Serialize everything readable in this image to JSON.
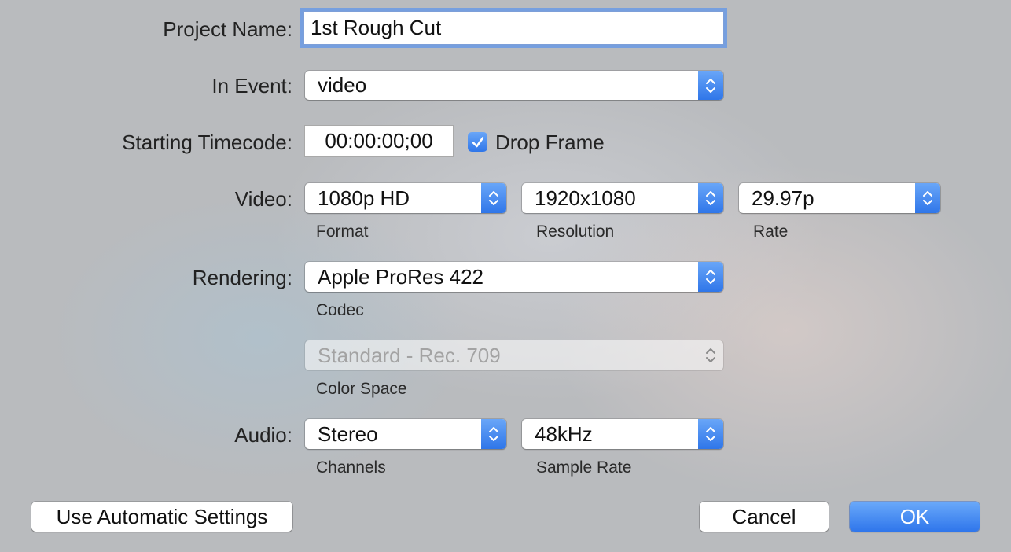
{
  "project_name": {
    "label": "Project Name:",
    "value": "1st Rough Cut"
  },
  "in_event": {
    "label": "In Event:",
    "value": "video"
  },
  "starting_timecode": {
    "label": "Starting Timecode:",
    "value": "00:00:00;00",
    "drop_frame_label": "Drop Frame",
    "drop_frame_checked": true
  },
  "video": {
    "label": "Video:",
    "format": {
      "value": "1080p HD",
      "caption": "Format"
    },
    "resolution": {
      "value": "1920x1080",
      "caption": "Resolution"
    },
    "rate": {
      "value": "29.97p",
      "caption": "Rate"
    }
  },
  "rendering": {
    "label": "Rendering:",
    "codec": {
      "value": "Apple ProRes 422",
      "caption": "Codec"
    },
    "color_space": {
      "value": "Standard - Rec. 709",
      "caption": "Color Space",
      "enabled": false
    }
  },
  "audio": {
    "label": "Audio:",
    "channels": {
      "value": "Stereo",
      "caption": "Channels"
    },
    "sample_rate": {
      "value": "48kHz",
      "caption": "Sample Rate"
    }
  },
  "buttons": {
    "automatic": "Use Automatic Settings",
    "cancel": "Cancel",
    "ok": "OK"
  },
  "colors": {
    "accent": "#3b82f0",
    "disabled_text": "#a3a3a3"
  }
}
